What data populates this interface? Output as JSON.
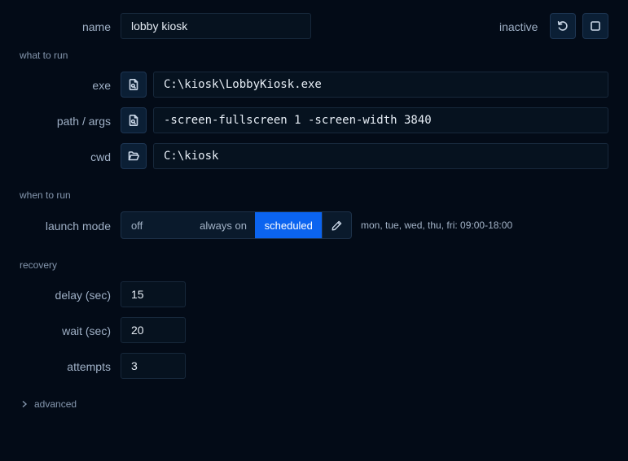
{
  "header": {
    "name_label": "name",
    "name_value": "lobby kiosk",
    "status": "inactive",
    "restart_icon": "rotate-ccw-icon",
    "stop_icon": "square-icon"
  },
  "what_to_run": {
    "section_label": "what to run",
    "exe_label": "exe",
    "exe_value": "C:\\kiosk\\LobbyKiosk.exe",
    "args_label": "path / args",
    "args_value": "-screen-fullscreen 1 -screen-width 3840",
    "cwd_label": "cwd",
    "cwd_value": "C:\\kiosk"
  },
  "when_to_run": {
    "section_label": "when to run",
    "launch_mode_label": "launch mode",
    "options": [
      "off",
      "always on",
      "scheduled"
    ],
    "selected": "scheduled",
    "schedule": "mon, tue, wed, thu, fri: 09:00-18:00"
  },
  "recovery": {
    "section_label": "recovery",
    "delay_label": "delay (sec)",
    "delay_value": "15",
    "wait_label": "wait (sec)",
    "wait_value": "20",
    "attempts_label": "attempts",
    "attempts_value": "3"
  },
  "advanced": {
    "label": "advanced"
  },
  "colors": {
    "background": "#030b17",
    "accent": "#0b64f0",
    "field_bg": "#06121f",
    "border": "#17283b"
  }
}
